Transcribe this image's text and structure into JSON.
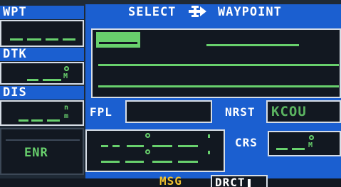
{
  "colors": {
    "panel_blue": "#1b5fd0",
    "screen_dark": "#121821",
    "green": "#68d06d",
    "white": "#ffffff",
    "amber": "#f2c230"
  },
  "left": {
    "wpt": {
      "label": "WPT"
    },
    "dtk": {
      "label": "DTK",
      "unit": "M"
    },
    "dis": {
      "label": "DIS",
      "unit_top": "n",
      "unit_bottom": "m"
    },
    "mode": {
      "label": "ENR"
    }
  },
  "panel": {
    "title_left": "SELECT",
    "title_icon": "direct-to-icon",
    "title_right": "WAYPOINT",
    "fpl_label": "FPL",
    "nrst_label": "NRST",
    "nrst_value": "KCOU",
    "crs_label": "CRS",
    "crs_unit": "M"
  },
  "status_bar": {
    "msg": "MSG",
    "drct": "DRCT"
  }
}
